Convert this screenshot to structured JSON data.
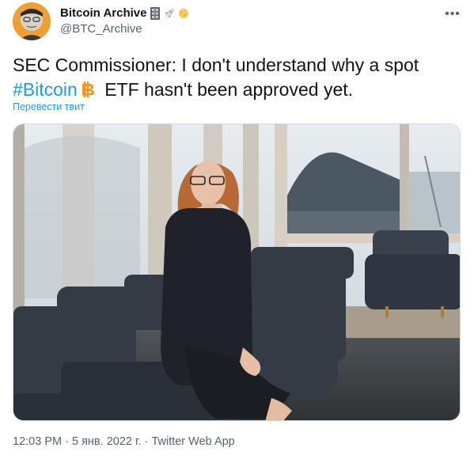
{
  "author": {
    "display_name": "Bitcoin Archive",
    "handle": "@BTC_Archive",
    "name_emojis": [
      "file-cabinet-icon",
      "rocket-icon",
      "moon-icon"
    ]
  },
  "more_label": "•••",
  "tweet": {
    "text_before": "SEC Commissioner: I don't understand why a spot",
    "hashtag": "#Bitcoin",
    "text_after": "ETF hasn't been approved yet."
  },
  "translate_label": "Перевести твит",
  "meta": {
    "time": "12:03 PM",
    "separator1": "·",
    "date": "5 янв. 2022 г.",
    "separator2": "·",
    "app": "Twitter Web App"
  },
  "colors": {
    "link": "#1d9bf0",
    "text": "#0f1419",
    "secondary": "#536471",
    "bitcoin_orange": "#f7931a"
  }
}
